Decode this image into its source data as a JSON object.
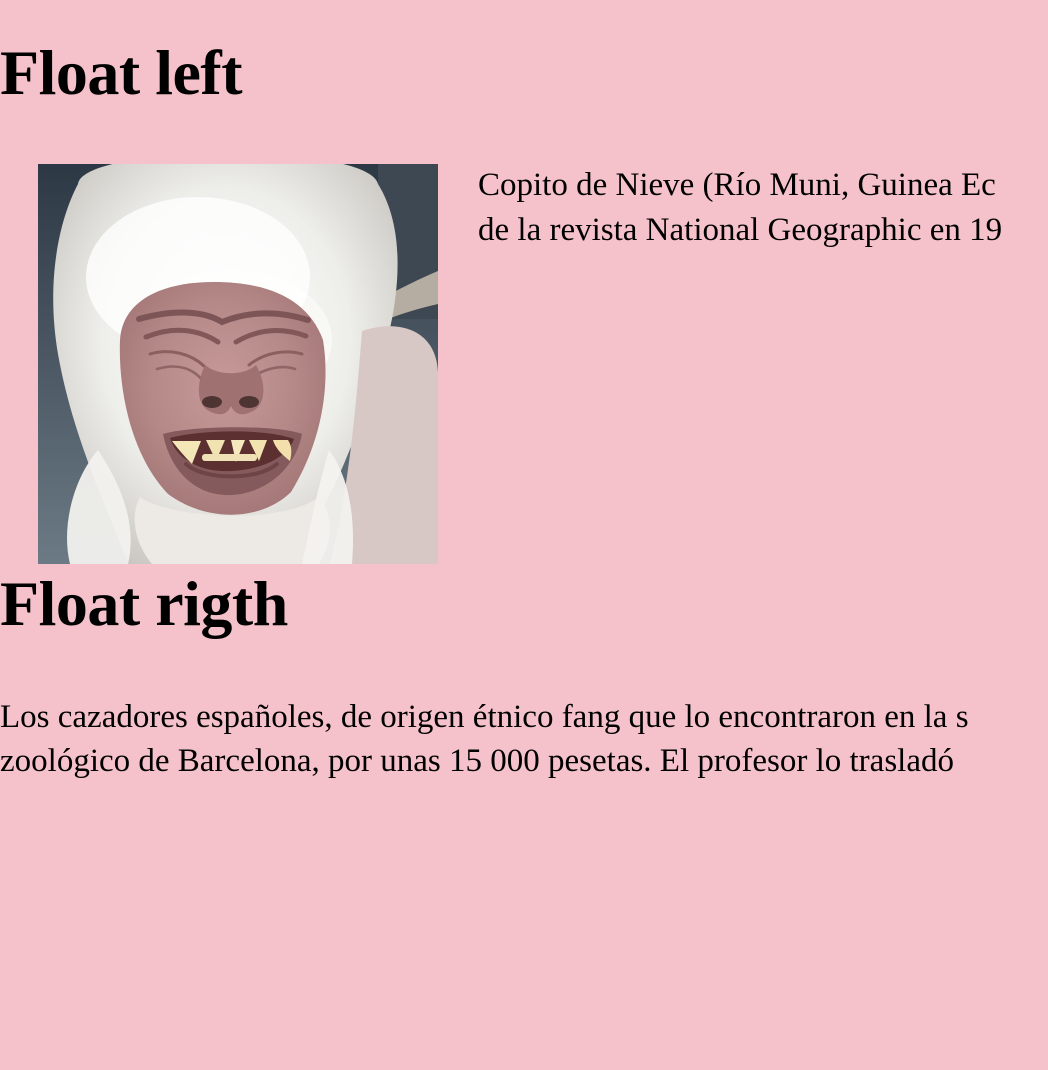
{
  "sections": [
    {
      "heading": "Float left",
      "image_subject": "white gorilla",
      "paragraph_lines": [
        "Copito de Nieve (Río Muni, Guinea Ec",
        "de la revista National Geographic en 19"
      ]
    },
    {
      "heading": "Float rigth",
      "paragraph_lines": [
        "Los cazadores españoles, de origen étnico fang que lo encontraron en la s",
        "zoológico de Barcelona, por unas 15 000 pesetas. El profesor lo trasladó"
      ]
    }
  ],
  "colors": {
    "background": "#f5c2cb",
    "text": "#000000"
  }
}
